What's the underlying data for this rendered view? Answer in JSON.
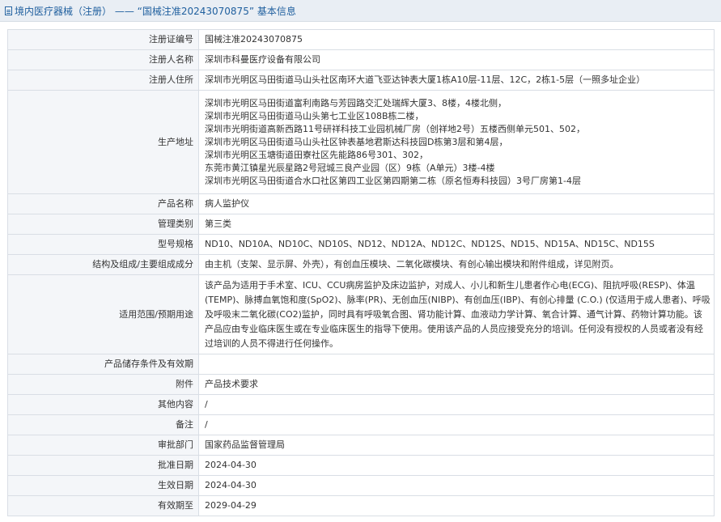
{
  "header": {
    "title": "境内医疗器械（注册） —— “国械注准20243070875” 基本信息"
  },
  "fields": {
    "reg_no": {
      "label": "注册证编号",
      "value": "国械注准20243070875"
    },
    "registrant": {
      "label": "注册人名称",
      "value": "深圳市科曼医疗设备有限公司"
    },
    "registrant_addr": {
      "label": "注册人住所",
      "value": "深圳市光明区马田街道马山头社区南环大道飞亚达钟表大厦1栋A10层-11层、12C，2栋1-5层（一照多址企业）"
    },
    "production_addr": {
      "label": "生产地址",
      "lines": [
        "深圳市光明区马田街道富利南路与芳园路交汇处瑞辉大厦3、8楼，4楼北侧，",
        "深圳市光明区马田街道马山头第七工业区108B栋二楼，",
        "深圳市光明街道高新西路11号研祥科技工业园机械厂房（创祥地2号）五楼西侧单元501、502，",
        "深圳市光明区马田街道马山头社区钟表基地君斯达科技园D栋第3层和第4层，",
        "深圳市光明区玉塘街道田寮社区先能路86号301、302，",
        "东莞市黄江镇星光辰星路2号冠城三良产业园（区）9栋（A单元）3楼-4楼",
        "深圳市光明区马田街道合水口社区第四工业区第四期第二栋（原名恒寿科技园）3号厂房第1-4层"
      ]
    },
    "product_name": {
      "label": "产品名称",
      "value": "病人监护仪"
    },
    "category": {
      "label": "管理类别",
      "value": "第三类"
    },
    "models": {
      "label": "型号规格",
      "value": "ND10、ND10A、ND10C、ND10S、ND12、ND12A、ND12C、ND12S、ND15、ND15A、ND15C、ND15S"
    },
    "structure": {
      "label": "结构及组成/主要组成成分",
      "value": "由主机（支架、显示屏、外壳），有创血压模块、二氧化碳模块、有创心输出模块和附件组成，详见附页。"
    },
    "scope": {
      "label": "适用范围/预期用途",
      "value": "该产品为适用于手术室、ICU、CCU病房监护及床边监护，对成人、小儿和新生儿患者作心电(ECG)、阻抗呼吸(RESP)、体温(TEMP)、脉搏血氧饱和度(SpO2)、脉率(PR)、无创血压(NIBP)、有创血压(IBP)、有创心排量 (C.O.) (仅适用于成人患者)、呼吸及呼吸末二氧化碳(CO2)监护，同时具有呼吸氧合图、肾功能计算、血液动力学计算、氧合计算、通气计算、药物计算功能。该产品应由专业临床医生或在专业临床医生的指导下使用。使用该产品的人员应接受充分的培训。任何没有授权的人员或者没有经过培训的人员不得进行任何操作。"
    },
    "storage": {
      "label": "产品储存条件及有效期",
      "value": ""
    },
    "attachment": {
      "label": "附件",
      "value": "产品技术要求"
    },
    "other": {
      "label": "其他内容",
      "value": "/"
    },
    "remark": {
      "label": "备注",
      "value": "/"
    },
    "approval_dept": {
      "label": "审批部门",
      "value": "国家药品监督管理局"
    },
    "approval_date": {
      "label": "批准日期",
      "value": "2024-04-30"
    },
    "effective_date": {
      "label": "生效日期",
      "value": "2024-04-30"
    },
    "expiry_date": {
      "label": "有效期至",
      "value": "2029-04-29"
    }
  }
}
